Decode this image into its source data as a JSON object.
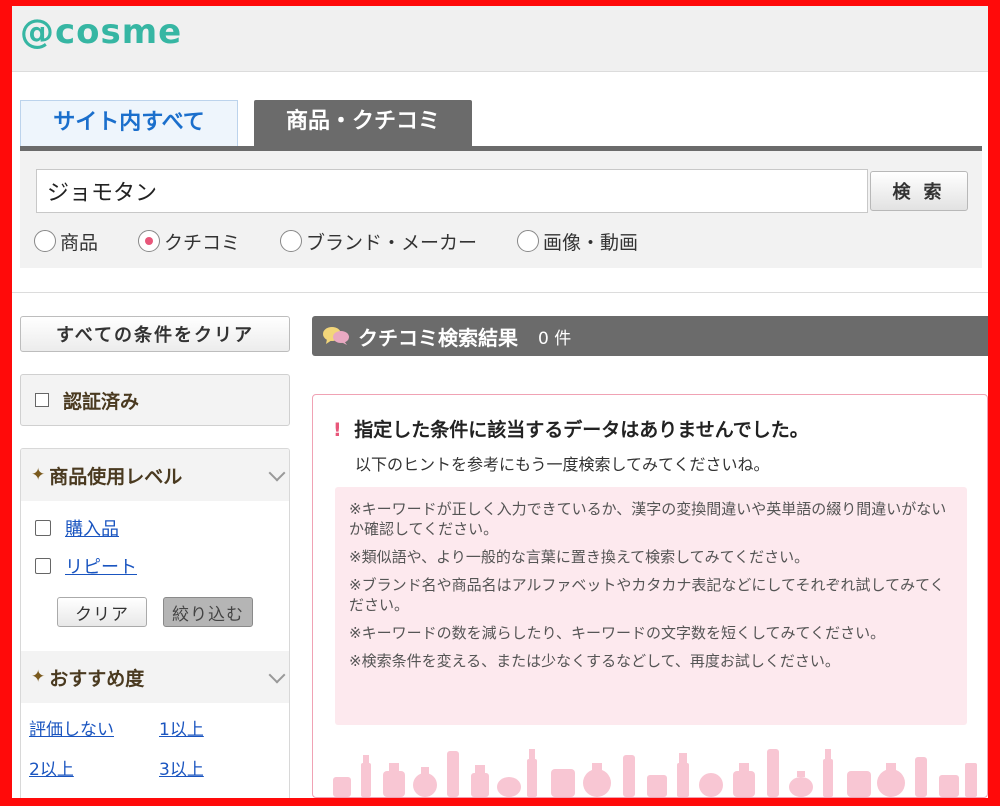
{
  "header": {
    "logo": "@cosme"
  },
  "tabs": [
    {
      "label": "サイト内すべて"
    },
    {
      "label": "商品・クチコミ"
    }
  ],
  "search": {
    "value": "ジョモタン",
    "button_label": "検 索",
    "radios": [
      {
        "label": "商品",
        "checked": false
      },
      {
        "label": "クチコミ",
        "checked": true
      },
      {
        "label": "ブランド・メーカー",
        "checked": false
      },
      {
        "label": "画像・動画",
        "checked": false
      }
    ]
  },
  "sidebar": {
    "clear_all": "すべての条件をクリア",
    "verified": "認証済み",
    "usage_level": {
      "title": "商品使用レベル",
      "options": [
        "購入品",
        "リピート"
      ],
      "clear": "クリア",
      "apply": "絞り込む"
    },
    "recommend": {
      "title": "おすすめ度",
      "links": [
        "評価しない",
        "1以上",
        "2以上",
        "3以上"
      ]
    }
  },
  "results": {
    "title": "クチコミ検索結果",
    "count": "0 件",
    "noresult_title": "指定した条件に該当するデータはありませんでした。",
    "noresult_sub": "以下のヒントを参考にもう一度検索してみてくださいね。",
    "hints": [
      "※キーワードが正しく入力できているか、漢字の変換間違いや英単語の綴り間違いがないか確認してください。",
      "※類似語や、より一般的な言葉に置き換えて検索してみてください。",
      "※ブランド名や商品名はアルファベットやカタカナ表記などにしてそれぞれ試してみてください。",
      "※キーワードの数を減らしたり、キーワードの文字数を短くしてみてください。",
      "※検索条件を変える、または少なくするなどして、再度お試しください。"
    ]
  },
  "colors": {
    "brand": "#36b6a3",
    "frame": "#ff0a0a",
    "pink": "#e8577a",
    "tab_dark": "#6b6b6b"
  }
}
